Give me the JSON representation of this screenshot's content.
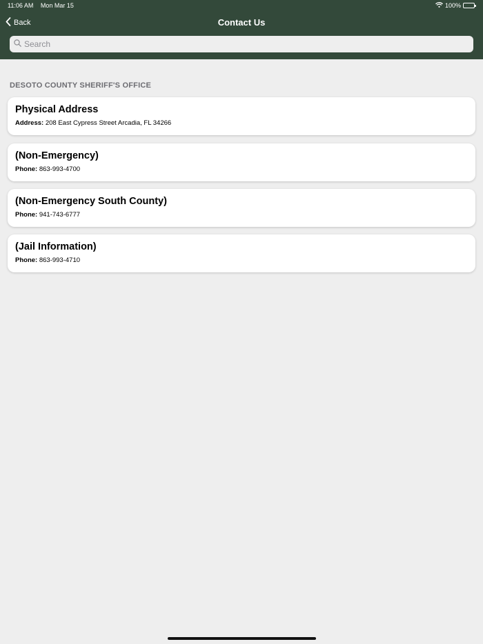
{
  "status_bar": {
    "time": "11:06 AM",
    "date": "Mon Mar 15",
    "battery": "100%"
  },
  "nav": {
    "back_label": "Back",
    "title": "Contact Us"
  },
  "search": {
    "placeholder": "Search"
  },
  "section": {
    "title": "DESOTO COUNTY SHERIFF'S OFFICE"
  },
  "contacts": [
    {
      "title": "Physical Address",
      "label": "Address:",
      "value": "208 East Cypress Street Arcadia, FL  34266"
    },
    {
      "title": "(Non-Emergency)",
      "label": "Phone:",
      "value": "863-993-4700"
    },
    {
      "title": "(Non-Emergency South County)",
      "label": "Phone:",
      "value": "941-743-6777"
    },
    {
      "title": "(Jail Information)",
      "label": "Phone:",
      "value": "863-993-4710"
    }
  ],
  "colors": {
    "header": "#33493a",
    "background": "#eeeeee",
    "card": "#ffffff"
  },
  "icons": {
    "back": "chevron-left-icon",
    "search": "search-icon",
    "wifi": "wifi-icon",
    "battery": "battery-icon"
  }
}
